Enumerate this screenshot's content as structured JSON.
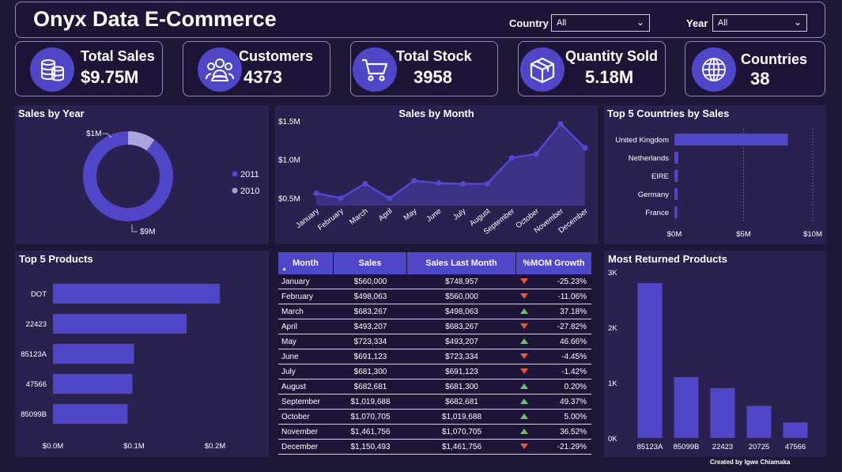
{
  "header": {
    "title": "Onyx Data E-Commerce",
    "country_label": "Country",
    "country_value": "All",
    "year_label": "Year",
    "year_value": "All"
  },
  "kpis": [
    {
      "label": "Total Sales",
      "value": "$9.75M",
      "icon": "coins-icon"
    },
    {
      "label": "Customers",
      "value": "4373",
      "icon": "users-icon"
    },
    {
      "label": "Total Stock",
      "value": "3958",
      "icon": "cart-icon"
    },
    {
      "label": "Quantity Sold",
      "value": "5.18M",
      "icon": "box-icon"
    },
    {
      "label": "Countries",
      "value": "38",
      "icon": "globe-icon"
    }
  ],
  "colors": {
    "accent": "#4f46c8",
    "accent_light": "#a9a4dd",
    "up": "#6fbf73",
    "down": "#e8573a",
    "panel": "#2a2150"
  },
  "panels": {
    "sales_by_year": "Sales by Year",
    "sales_by_month": "Sales by Month",
    "top_countries": "Top 5 Countries by Sales",
    "top_products": "Top 5 Products",
    "most_returned": "Most Returned Products"
  },
  "chart_data": [
    {
      "type": "pie",
      "title": "Sales by Year",
      "categories": [
        "2011",
        "2010"
      ],
      "values": [
        9,
        1
      ],
      "labels": [
        "$9M",
        "$1M"
      ],
      "legend": "right",
      "colors": [
        "#4f46c8",
        "#a9a4dd"
      ]
    },
    {
      "type": "area",
      "title": "Sales by Month",
      "categories": [
        "January",
        "February",
        "March",
        "April",
        "May",
        "June",
        "July",
        "August",
        "September",
        "October",
        "November",
        "December"
      ],
      "values": [
        560000,
        498063,
        683267,
        493207,
        723334,
        691123,
        681300,
        682681,
        1019688,
        1070705,
        1461756,
        1150493
      ],
      "yticks": [
        "$0.5M",
        "$1.0M",
        "$1.5M"
      ],
      "ylim": [
        400000,
        1500000
      ]
    },
    {
      "type": "bar",
      "title": "Top 5 Countries by Sales",
      "categories": [
        "United Kingdom",
        "Netherlands",
        "EIRE",
        "Germany",
        "France"
      ],
      "values": [
        8200000,
        285000,
        265000,
        230000,
        210000
      ],
      "xticks": [
        "$0M",
        "$5M",
        "$10M"
      ],
      "xlim": [
        0,
        10000000
      ]
    },
    {
      "type": "bar",
      "title": "Top 5 Products",
      "categories": [
        "DOT",
        "22423",
        "85123A",
        "47566",
        "85099B"
      ],
      "values": [
        206000,
        165000,
        100000,
        98000,
        92000
      ],
      "xticks": [
        "$0.0M",
        "$0.1M",
        "$0.2M"
      ],
      "xlim": [
        0,
        200000
      ]
    },
    {
      "type": "bar",
      "title": "Most Returned Products",
      "categories": [
        "85123A",
        "85099B",
        "22423",
        "20725",
        "47566"
      ],
      "values": [
        2800,
        1100,
        900,
        580,
        280
      ],
      "yticks": [
        "0K",
        "1K",
        "2K",
        "3K"
      ],
      "ylim": [
        0,
        3000
      ]
    },
    {
      "type": "table",
      "columns": [
        "Month",
        "Sales",
        "Sales Last Month",
        "%MOM Growth"
      ],
      "rows": [
        {
          "month": "January",
          "sales": "$560,000",
          "last": "$748,957",
          "growth": "-25.23%",
          "dir": "down"
        },
        {
          "month": "February",
          "sales": "$498,063",
          "last": "$560,000",
          "growth": "-11.06%",
          "dir": "down"
        },
        {
          "month": "March",
          "sales": "$683,267",
          "last": "$498,063",
          "growth": "37.18%",
          "dir": "up"
        },
        {
          "month": "April",
          "sales": "$493,207",
          "last": "$683,267",
          "growth": "-27.82%",
          "dir": "down"
        },
        {
          "month": "May",
          "sales": "$723,334",
          "last": "$493,207",
          "growth": "46.66%",
          "dir": "up"
        },
        {
          "month": "June",
          "sales": "$691,123",
          "last": "$723,334",
          "growth": "-4.45%",
          "dir": "down"
        },
        {
          "month": "July",
          "sales": "$681,300",
          "last": "$691,123",
          "growth": "-1.42%",
          "dir": "down"
        },
        {
          "month": "August",
          "sales": "$682,681",
          "last": "$681,300",
          "growth": "0.20%",
          "dir": "up"
        },
        {
          "month": "September",
          "sales": "$1,019,688",
          "last": "$682,681",
          "growth": "49.37%",
          "dir": "up"
        },
        {
          "month": "October",
          "sales": "$1,070,705",
          "last": "$1,019,688",
          "growth": "5.00%",
          "dir": "up"
        },
        {
          "month": "November",
          "sales": "$1,461,756",
          "last": "$1,070,705",
          "growth": "36.52%",
          "dir": "up"
        },
        {
          "month": "December",
          "sales": "$1,150,493",
          "last": "$1,461,756",
          "growth": "-21.29%",
          "dir": "down"
        }
      ]
    }
  ],
  "footer": {
    "credit": "Created by Igwe Chiamaka"
  }
}
